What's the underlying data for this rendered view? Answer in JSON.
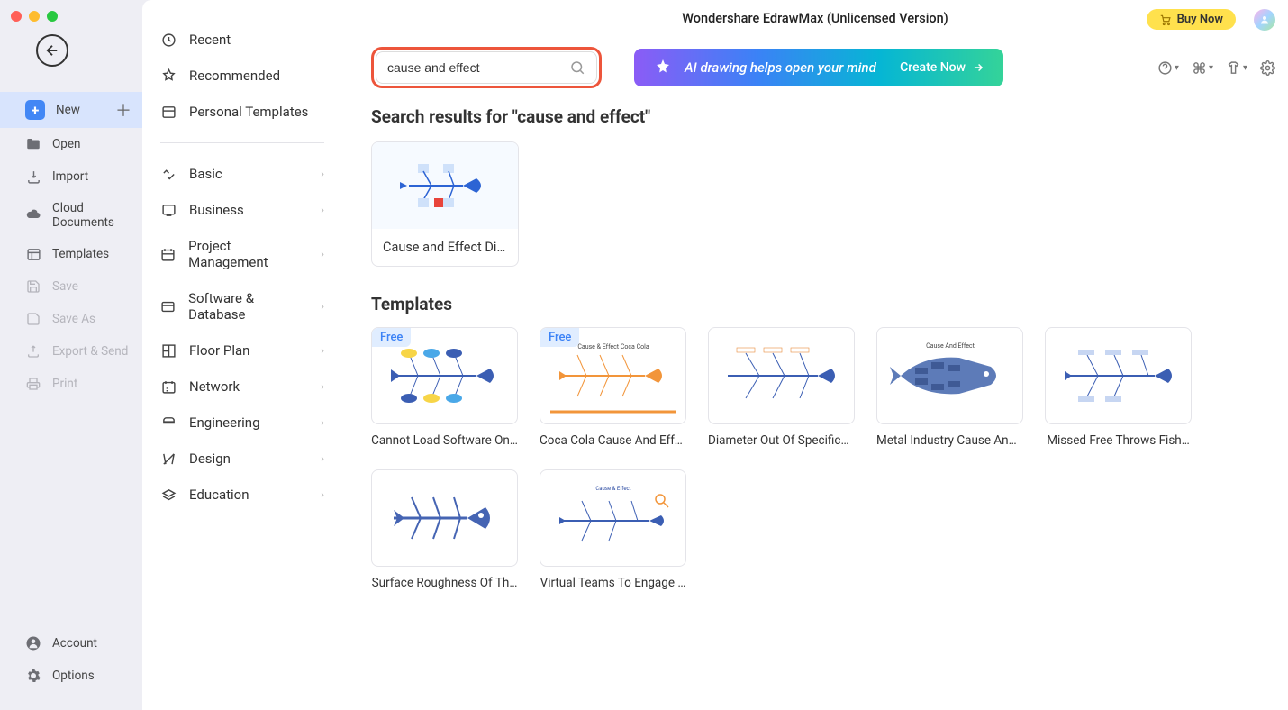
{
  "app": {
    "title": "Wondershare EdrawMax (Unlicensed Version)"
  },
  "header": {
    "buy_now": "Buy Now",
    "search_value": "cause and effect",
    "ai_banner_text": "AI drawing helps open your mind",
    "ai_create": "Create Now"
  },
  "sidebar_left": {
    "new": "New",
    "open": "Open",
    "import": "Import",
    "cloud_documents": "Cloud Documents",
    "templates": "Templates",
    "save": "Save",
    "save_as": "Save As",
    "export_send": "Export & Send",
    "print": "Print",
    "account": "Account",
    "options": "Options"
  },
  "sidebar_mid": {
    "recent": "Recent",
    "recommended": "Recommended",
    "personal_templates": "Personal Templates",
    "categories": [
      "Basic",
      "Business",
      "Project Management",
      "Software & Database",
      "Floor Plan",
      "Network",
      "Engineering",
      "Design",
      "Education"
    ]
  },
  "content": {
    "search_results_heading": "Search results for \"cause and effect\"",
    "result_label": "Cause and Effect Di…",
    "templates_heading": "Templates",
    "free_label": "Free",
    "templates": [
      {
        "label": "Cannot Load Software On…",
        "free": true
      },
      {
        "label": "Coca Cola Cause And Effect",
        "free": true
      },
      {
        "label": "Diameter Out Of Specifica…",
        "free": false
      },
      {
        "label": "Metal Industry Cause And…",
        "free": false
      },
      {
        "label": "Missed Free Throws Fish…",
        "free": false
      },
      {
        "label": "Surface Roughness Of Th…",
        "free": false
      },
      {
        "label": "Virtual Teams To Engage …",
        "free": false
      }
    ]
  }
}
